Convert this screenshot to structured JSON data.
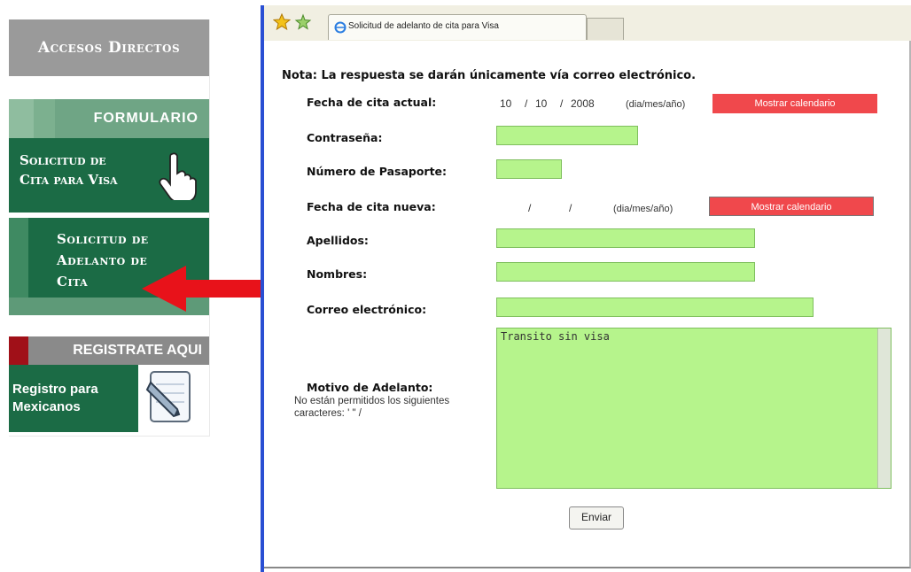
{
  "sidebar": {
    "accesos_title": "Accesos Directos",
    "formulario": {
      "header": "FORMULARIO",
      "line1": "Solicitud de",
      "line2": "Cita para Visa"
    },
    "adelanto": {
      "line1": "Solicitud de",
      "line2": "Adelanto de",
      "line3": "Cita"
    },
    "registrate": {
      "header": "REGISTRATE AQUI",
      "line1": "Registro para",
      "line2": "Mexicanos"
    }
  },
  "browser": {
    "tab_title": "Solicitud de adelanto de cita para Visa"
  },
  "form": {
    "nota": "Nota: La respuesta se darán únicamente vía correo electrónico.",
    "fecha_actual": {
      "label": "Fecha de cita actual:",
      "day": "10",
      "sep1": "/",
      "month": "10",
      "sep2": "/",
      "year": "2008",
      "format": "(dia/mes/año)",
      "calendar_button": "Mostrar calendario"
    },
    "contrasena_label": "Contraseña:",
    "pasaporte_label": "Número de Pasaporte:",
    "fecha_nueva": {
      "label": "Fecha de cita nueva:",
      "sep1": "/",
      "sep2": "/",
      "format": "(dia/mes/año)",
      "calendar_button": "Mostrar calendario"
    },
    "apellidos_label": "Apellidos:",
    "nombres_label": "Nombres:",
    "correo_label": "Correo electrónico:",
    "motivo_label": "Motivo de Adelanto:",
    "motivo_note": "No están permitidos los siguientes caracteres: ' \" /",
    "motivo_value": "Transito sin visa",
    "submit_label": "Enviar"
  },
  "colors": {
    "field_green": "#b6f48c",
    "sidebar_green": "#1b6b45",
    "calendar_red": "#f0484c",
    "arrow_red": "#e8121a"
  }
}
